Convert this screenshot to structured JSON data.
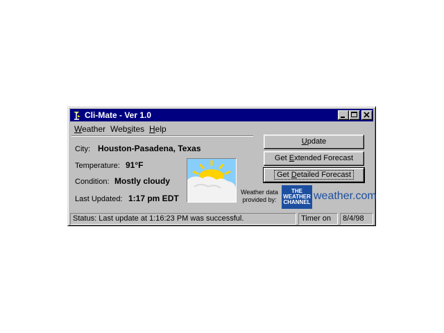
{
  "window": {
    "title": "Cli-Mate - Ver 1.0"
  },
  "menu": {
    "items": [
      {
        "key": "W",
        "rest": "eather"
      },
      {
        "key": "",
        "pre": "Web",
        "key2": "s",
        "rest": "ites"
      },
      {
        "key": "H",
        "rest": "elp"
      }
    ]
  },
  "info": {
    "city_label": "City:",
    "city_value": "Houston-Pasadena, Texas",
    "temperature_label": "Temperature:",
    "temperature_value": "91°F",
    "condition_label": "Condition:",
    "condition_value": "Mostly cloudy",
    "updated_label": "Last Updated:",
    "updated_value": "1:17 pm EDT"
  },
  "buttons": {
    "update": {
      "pre": "",
      "key": "U",
      "post": "pdate"
    },
    "extended": {
      "pre": "Get ",
      "key": "E",
      "post": "xtended Forecast"
    },
    "detailed": {
      "pre": "Get ",
      "key": "D",
      "post": "etailed Forecast"
    }
  },
  "provider": {
    "label_line1": "Weather data",
    "label_line2": "provided by:",
    "logo_line1": "THE",
    "logo_line2": "WEATHER",
    "logo_line3": "CHANNEL",
    "site": "weather.com"
  },
  "status": {
    "message": "Status: Last update at 1:16:23 PM was successful.",
    "timer": "Timer on",
    "date": "8/4/98"
  },
  "colors": {
    "titlebar": "#000080",
    "face": "#c0c0c0",
    "brand_blue": "#1d4fa0",
    "sun": "#ffd200"
  },
  "icons": {
    "app": "weather-vane-icon",
    "condition": "partly-cloudy-icon"
  }
}
